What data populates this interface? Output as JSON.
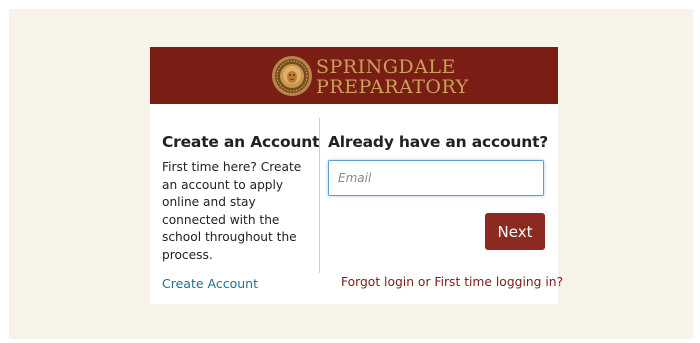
{
  "branding": {
    "name_line1": "SPRINGDALE",
    "name_line2": "PREPARATORY",
    "banner_color": "#7a1d14",
    "seal_icon": "lion-seal-icon"
  },
  "create_account": {
    "heading": "Create an Account",
    "description": "First time here? Create an account to apply online and stay connected with the school throughout the process.",
    "link_label": "Create Account"
  },
  "login": {
    "heading": "Already have an account?",
    "email_placeholder": "Email",
    "email_value": "",
    "next_label": "Next",
    "forgot_label": "Forgot login or First time logging in?"
  },
  "colors": {
    "page_background": "#f7f3e8",
    "link_blue": "#1f6f8e",
    "button": "#8c2a20"
  }
}
